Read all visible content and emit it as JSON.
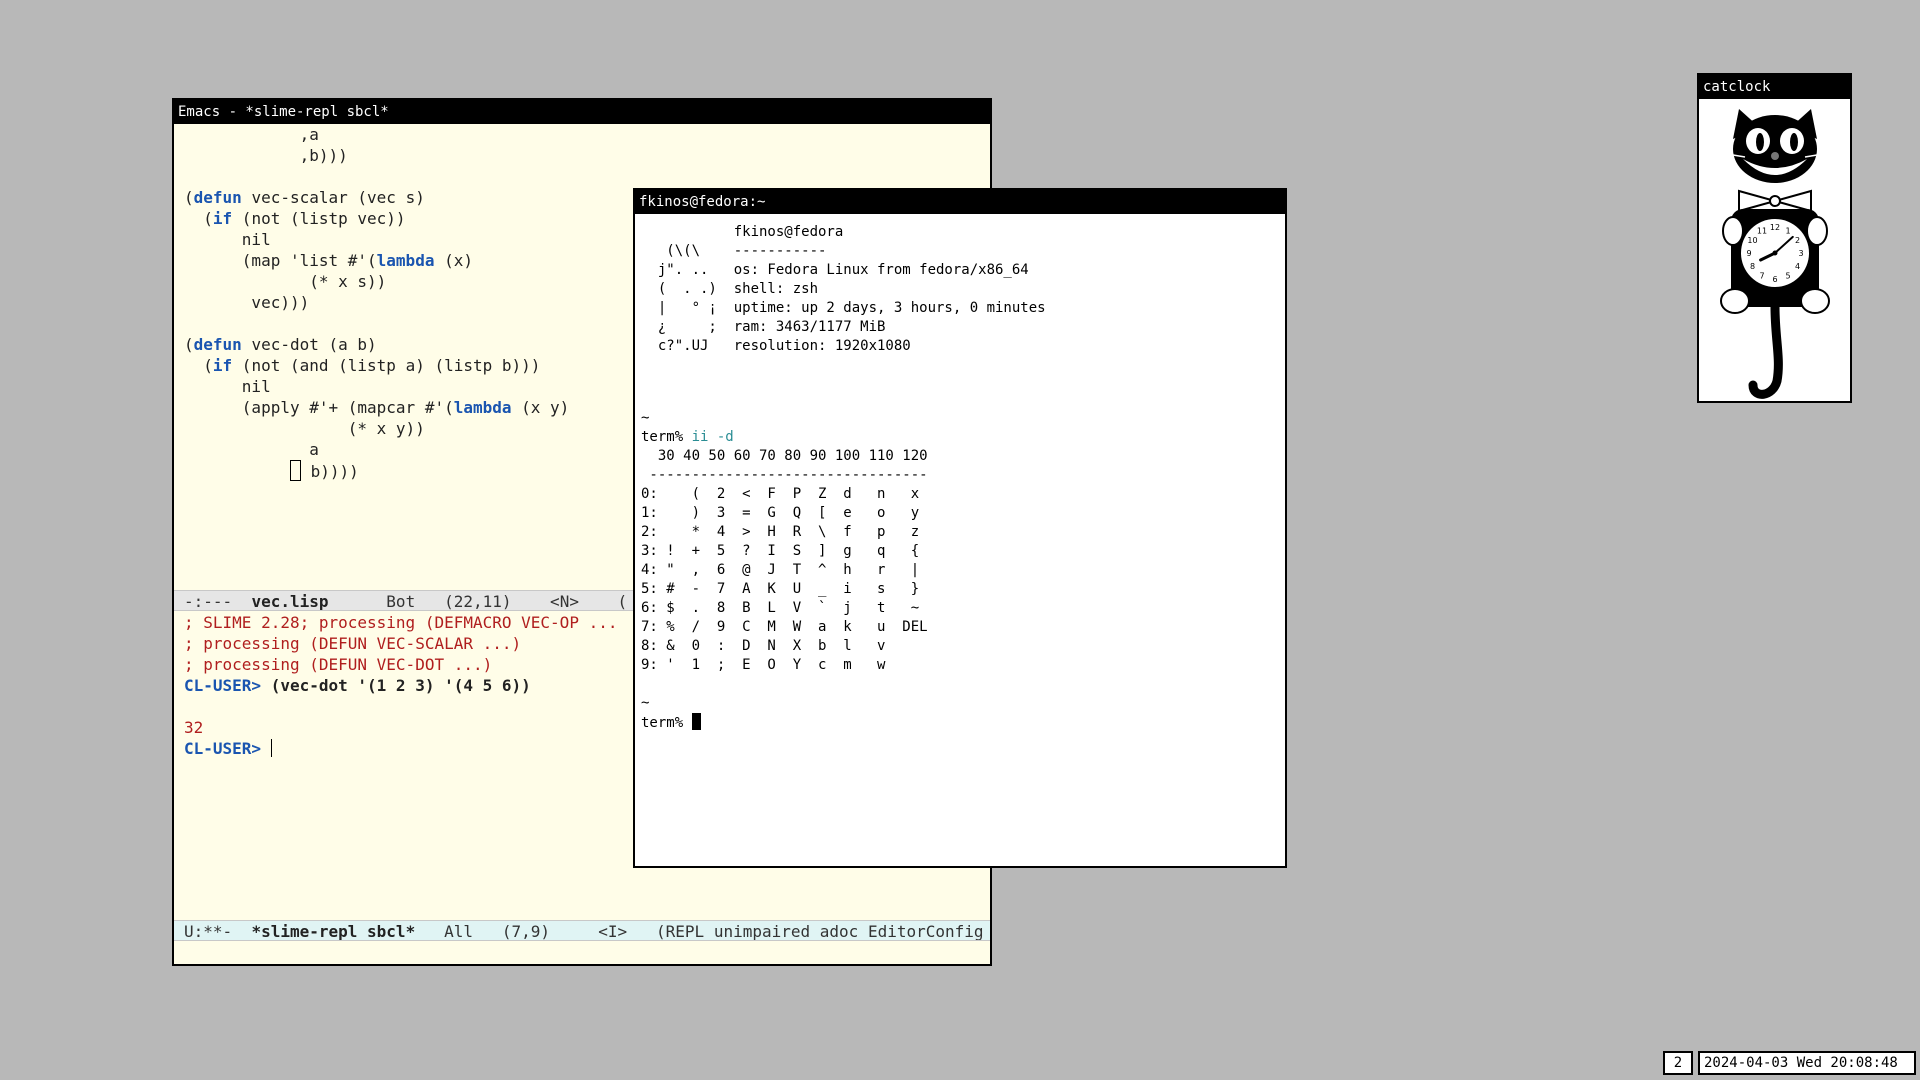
{
  "emacs": {
    "title": "Emacs - *slime-repl sbcl*",
    "code_lines": [
      "            ,a",
      "            ,b)))",
      "",
      "(defun vec-scalar (vec s)",
      "  (if (not (listp vec))",
      "      nil",
      "      (map 'list #'(lambda (x)",
      "             (* x s))",
      "       vec)))",
      "",
      "(defun vec-dot (a b)",
      "  (if (not (and (listp a) (listp b)))",
      "      nil",
      "      (apply #'+ (mapcar #'(lambda (x y)",
      "                 (* x y))",
      "             a",
      "             b))))"
    ],
    "modeline_top": "-:---  vec.lisp      Bot   (22,11)    <N>    (",
    "modeline_top_file": "vec.lisp",
    "repl_lines": [
      "; SLIME 2.28; processing (DEFMACRO VEC-OP ...",
      "; processing (DEFUN VEC-SCALAR ...)",
      "; processing (DEFUN VEC-DOT ...)"
    ],
    "repl_prompt": "CL-USER>",
    "repl_input": "(vec-dot '(1 2 3) '(4 5 6))",
    "repl_result": "32",
    "modeline_bottom_pre": "U:**-  ",
    "modeline_bottom_buffer": "*slime-repl sbcl*",
    "modeline_bottom_post": "   All   (7,9)     <I>   (REPL unimpaired adoc EditorConfig"
  },
  "terminal": {
    "title": "fkinos@fedora:~",
    "fetch_lines": [
      "           fkinos@fedora",
      "   (\\(\\    -----------",
      "  j\". ..   os: Fedora Linux from fedora/x86_64",
      "  (  . .)  shell: zsh",
      "  |   ° ¡  uptime: up 2 days, 3 hours, 0 minutes",
      "  ¿     ;  ram: 3463/1177 MiB",
      "  c?\".UJ   resolution: 1920x1080"
    ],
    "tilde": "~",
    "prompt": "term%",
    "command": "ii -d",
    "table_lines": [
      "  30 40 50 60 70 80 90 100 110 120",
      " ---------------------------------",
      "0:    (  2  <  F  P  Z  d   n   x",
      "1:    )  3  =  G  Q  [  e   o   y",
      "2:    *  4  >  H  R  \\  f   p   z",
      "3: !  +  5  ?  I  S  ]  g   q   {",
      "4: \"  ,  6  @  J  T  ^  h   r   |",
      "5: #  -  7  A  K  U  _  i   s   }",
      "6: $  .  8  B  L  V  `  j   t   ~",
      "7: %  /  9  C  M  W  a  k   u  DEL",
      "8: &  0  :  D  N  X  b  l   v",
      "9: '  1  ;  E  O  Y  c  m   w"
    ]
  },
  "catclock": {
    "title": "catclock",
    "hour": 8,
    "minute": 8,
    "dial_numbers": [
      "12",
      "1",
      "2",
      "3",
      "4",
      "5",
      "6",
      "7",
      "8",
      "9",
      "10",
      "11"
    ]
  },
  "status": {
    "workspace": "2",
    "datetime": "2024-04-03 Wed 20:08:48"
  }
}
